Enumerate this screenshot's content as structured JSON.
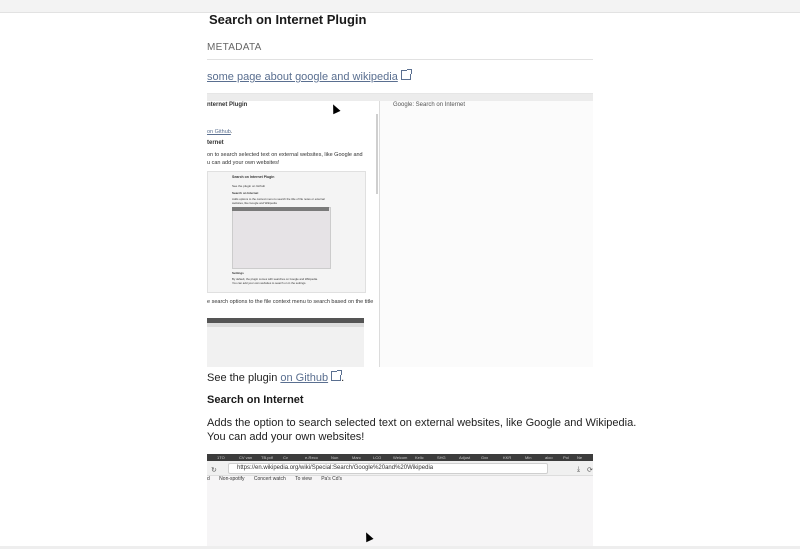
{
  "page": {
    "title": "Search on Internet Plugin",
    "metadata_label": "METADATA",
    "top_link": "some page about google and wikipedia",
    "see_plugin_prefix": "See the plugin ",
    "see_plugin_link": "on Github",
    "see_plugin_suffix": ".",
    "section_heading": "Search on Internet",
    "section_text_line1": "Adds the option to search selected text on external websites, like Google and Wikipedia.",
    "section_text_line2": "You can add your own websites!"
  },
  "screenshot": {
    "left_title": "nternet Plugin",
    "right_title": "Google: Search on Internet",
    "github_prefix": "",
    "github_link": "on Github",
    "github_suffix": ".",
    "section_fragment": "ternet",
    "desc_line1": "on to search selected text on external websites, like Google and",
    "desc_line2": "u can add your own websites!",
    "inner_title": "Search on Internet Plugin",
    "inner_line1": "See the plugin on Github",
    "inner_heading": "Search on Internet",
    "inner_line2": "Adds options to the context menu to search the title of file notes or external",
    "inner_line3": "websites, like Google and Wikipedia",
    "inner_settings": "Settings",
    "inner_settings_text1": "By default, the plugin comes with searches on Google and Wikipedia.",
    "inner_settings_text2": "You can add your own websites to search on in the settings.",
    "context_text": "e search options to the file context menu to search based on the title"
  },
  "browser": {
    "url": "https://en.wikipedia.org/wiki/Special:Search/Google%20and%20Wikipedia",
    "bookmarks": [
      "Non-spotify",
      "Concert watch",
      "To view",
      "Pa's Cd's"
    ],
    "tabs": [
      "1TO",
      "CV van",
      "TB.pdf",
      "Cv",
      "e-Reco",
      "Nun",
      "Marc",
      "LCO",
      "Welcom",
      "Kelic",
      "SHG",
      "Adjust",
      "Gxx",
      "KKR",
      "Min",
      "aloo",
      "Pol",
      "Ne",
      "Pw"
    ]
  }
}
